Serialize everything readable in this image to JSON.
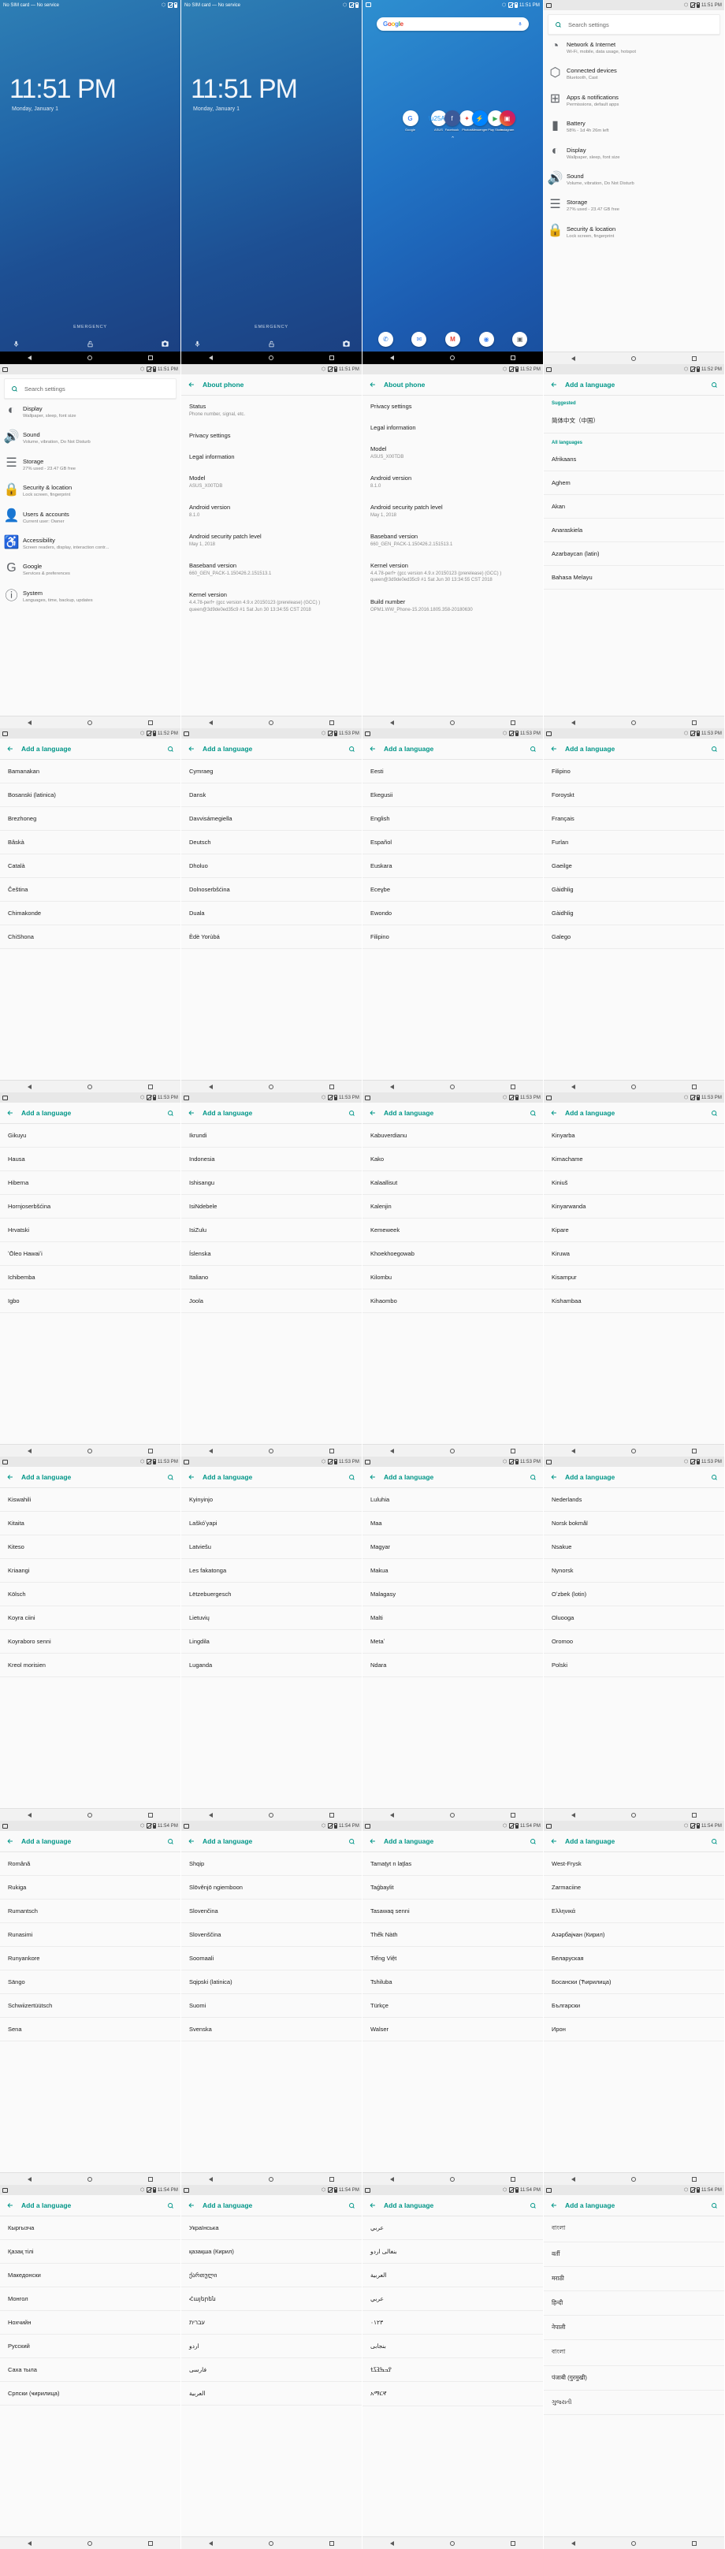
{
  "device": {
    "lockscreen": {
      "carrier": "No SIM card — No service",
      "time": "11:51 PM",
      "date": "Monday, January 1",
      "emergency": "EMERGENCY",
      "mic_icon": "microphone-icon",
      "lock_icon": "unlock-icon",
      "camera_icon": "camera-icon"
    },
    "homescreen": {
      "google_logo": [
        "G",
        "o",
        "o",
        "g",
        "l",
        "e"
      ],
      "mic_icon": "microphone-icon",
      "apps": [
        {
          "label": "Google",
          "color": "#ffffff",
          "glyph": "G",
          "fg": "#4285F4"
        },
        {
          "label": "ASUS",
          "color": "#ffffff",
          "glyph": "■",
          "fg": "#2196F3"
        },
        {
          "label": "Photos",
          "color": "#ffffff",
          "glyph": "✶",
          "fg": "#EA4335"
        },
        {
          "label": "Play Store",
          "color": "#ffffff",
          "glyph": "▶",
          "fg": "#34A853"
        }
      ],
      "apps2": [
        {
          "label": "Facebook",
          "color": "#3b5998",
          "glyph": "f",
          "fg": "#ffffff"
        },
        {
          "label": "Messenger",
          "color": "#0084ff",
          "glyph": "⚡",
          "fg": "#ffffff"
        },
        {
          "label": "Instagram",
          "color": "#c13584",
          "glyph": "▣",
          "fg": "#ffffff"
        }
      ],
      "dock": [
        {
          "name": "phone-icon",
          "color": "#ffffff",
          "glyph": "✆",
          "fg": "#1a73e8"
        },
        {
          "name": "messages-icon",
          "color": "#ffffff",
          "glyph": "✉",
          "fg": "#4285F4"
        },
        {
          "name": "gmail-icon",
          "color": "#ffffff",
          "glyph": "M",
          "fg": "#EA4335"
        },
        {
          "name": "chrome-icon",
          "color": "#ffffff",
          "glyph": "◉",
          "fg": "#4285F4"
        },
        {
          "name": "camera-icon",
          "color": "#ffffff",
          "glyph": "■",
          "fg": "#5f6368"
        }
      ],
      "arrow": "⌃"
    },
    "statusbar": {
      "bt_icon": "bluetooth-icon",
      "sim_icon": "no-sim-icon",
      "battery_icon": "battery-icon",
      "screenshot_icon": "screenshot-icon",
      "times": {
        "t1151": "11:51 PM",
        "t1152": "11:52 PM",
        "t1153": "11:53 PM",
        "t1154": "11:54 PM"
      }
    },
    "navbar": {
      "back": "back-nav-button",
      "home": "home-nav-button",
      "recents": "recents-nav-button"
    }
  },
  "settings_search": {
    "placeholder": "Search settings",
    "search_icon": "search-icon"
  },
  "settings_list_1": {
    "items": [
      {
        "icon": "display-icon",
        "glyph": "◐",
        "title": "Display",
        "subtitle": "Wallpaper, sleep, font size"
      },
      {
        "icon": "sound-icon",
        "glyph": "🔊",
        "title": "Sound",
        "subtitle": "Volume, vibration, Do Not Disturb"
      },
      {
        "icon": "storage-icon",
        "glyph": "☰",
        "title": "Storage",
        "subtitle": "27% used - 23.47 GB free"
      },
      {
        "icon": "lock-icon",
        "glyph": "🔒",
        "title": "Security & location",
        "subtitle": "Lock screen, fingerprint"
      },
      {
        "icon": "user-icon",
        "glyph": "👤",
        "title": "Users & accounts",
        "subtitle": "Current user: Owner"
      },
      {
        "icon": "accessibility-icon",
        "glyph": "♿",
        "title": "Accessibility",
        "subtitle": "Screen readers, display, interaction contr..."
      },
      {
        "icon": "google-icon",
        "glyph": "G",
        "title": "Google",
        "subtitle": "Services & preferences"
      },
      {
        "icon": "system-icon",
        "glyph": "ⓘ",
        "title": "System",
        "subtitle": "Languages, time, backup, updates"
      }
    ]
  },
  "settings_list_2": {
    "items": [
      {
        "icon": "wifi-icon",
        "glyph": "◔",
        "title": "Network & Internet",
        "subtitle": "Wi-Fi, mobile, data usage, hotspot"
      },
      {
        "icon": "bluetooth-icon",
        "glyph": "⬡",
        "title": "Connected devices",
        "subtitle": "Bluetooth, Cast"
      },
      {
        "icon": "apps-icon",
        "glyph": "⊞",
        "title": "Apps & notifications",
        "subtitle": "Permissions, default apps"
      },
      {
        "icon": "battery-icon",
        "glyph": "▮",
        "title": "Battery",
        "subtitle": "58% - 1d 4h 26m left"
      },
      {
        "icon": "display-icon",
        "glyph": "◐",
        "title": "Display",
        "subtitle": "Wallpaper, sleep, font size"
      },
      {
        "icon": "sound-icon",
        "glyph": "🔊",
        "title": "Sound",
        "subtitle": "Volume, vibration, Do Not Disturb"
      },
      {
        "icon": "storage-icon",
        "glyph": "☰",
        "title": "Storage",
        "subtitle": "27% used - 23.47 GB free"
      },
      {
        "icon": "lock-icon",
        "glyph": "🔒",
        "title": "Security & location",
        "subtitle": "Lock screen, fingerprint"
      }
    ]
  },
  "about_phone": {
    "title": "About phone",
    "back_icon": "back-arrow-icon",
    "items_a": [
      {
        "title": "Status",
        "subtitle": "Phone number, signal, etc."
      },
      {
        "title": "Privacy settings",
        "subtitle": ""
      },
      {
        "title": "Legal information",
        "subtitle": ""
      },
      {
        "title": "Model",
        "subtitle": "ASUS_X00TDB"
      },
      {
        "title": "Android version",
        "subtitle": "8.1.0"
      },
      {
        "title": "Android security patch level",
        "subtitle": "May 1, 2018"
      },
      {
        "title": "Baseband version",
        "subtitle": "660_GEN_PACK-1.150426.2.151513.1"
      },
      {
        "title": "Kernel version",
        "subtitle": "4.4.78-perf+ (gcc version 4.9.x 20150123 (prerelease) (GCC) ) queen@3d9de0ed35c9 #1 Sat Jun 30 13:34:55 CST 2018"
      }
    ],
    "items_b": [
      {
        "title": "Privacy settings",
        "subtitle": ""
      },
      {
        "title": "Legal information",
        "subtitle": ""
      },
      {
        "title": "Model",
        "subtitle": "ASUS_X00TDB"
      },
      {
        "title": "Android version",
        "subtitle": "8.1.0"
      },
      {
        "title": "Android security patch level",
        "subtitle": "May 1, 2018"
      },
      {
        "title": "Baseband version",
        "subtitle": "660_GEN_PACK-1.150426.2.151513.1"
      },
      {
        "title": "Kernel version",
        "subtitle": "4.4.78-perf+ (gcc version 4.9.x 20150123 (prerelease) (GCC) ) queen@3d9de0ed35c9 #1 Sat Jun 30 13:34:55 CST 2018"
      },
      {
        "title": "Build number",
        "subtitle": "OPM1.WW_Phone-15.2016.1805.358-20180630"
      }
    ]
  },
  "add_language": {
    "title": "Add a language",
    "back_icon": "back-arrow-icon",
    "search_icon": "search-icon",
    "suggested_header": "Suggested",
    "all_header": "All languages",
    "suggested": [
      "简体中文（中国）"
    ],
    "pages": [
      [
        "Afrikaans",
        "Aghem",
        "Akan",
        "Anaraskiela",
        "Azarbaycan (latin)",
        "Bahasa Melayu"
      ],
      [
        "Bamanakan",
        "Bosanski (latinica)",
        "Brezhoneg",
        "Bâskà",
        "Català",
        "Čeština",
        "Chimakonde",
        "ChiShona"
      ],
      [
        "Cymraeg",
        "Dansk",
        "Davvisámegiella",
        "Deutsch",
        "Dholuo",
        "Dolnoserbšćina",
        "Duala",
        "Èdè Yorùbá"
      ],
      [
        "Eesti",
        "Ekegusii",
        "English",
        "Español",
        "Euskara",
        "Eceɣbe",
        "Ewondo",
        "Filipino"
      ],
      [
        "Filipino",
        "Foroyskt",
        "Français",
        "Furlan",
        "Gaeilge",
        "Gàidhlig",
        "Gàidhlig",
        "Galego"
      ],
      [
        "Gikuyu",
        "Hausa",
        "Hiberna",
        "Hornjoserbšćina",
        "Hrvatski",
        "ʻŌleo Hawaiʻi",
        "Ichibemba",
        "Igbo"
      ],
      [
        "Ikrundi",
        "Indonesia",
        "Ishisangu",
        "IsiNdebele",
        "IsiZulu",
        "Íslenska",
        "Italiano",
        "Joola"
      ],
      [
        "Kabuverdianu",
        "Kako",
        "Kalaallisut",
        "Kalenjin",
        "Kemeweek",
        "Khoekhoegowab",
        "Kilombu",
        "Kihaombo"
      ],
      [
        "Kinyarba",
        "Kimachame",
        "Kiniuš",
        "Kinyarwanda",
        "Kipare",
        "Kiruwa",
        "Kisampur",
        "Kishambaa"
      ],
      [
        "Kiswahili",
        "Kitaita",
        "Kiteso",
        "Kriaangi",
        "Kölsch",
        "Koyra ciini",
        "Koyraboro senni",
        "Kreol morisien"
      ],
      [
        "Kyinyinjo",
        "Laškóʼyapi",
        "Latviešu",
        "Les fakatonga",
        "Lëtzebuergesch",
        "Lietuvių",
        "Lingdila",
        "Luganda"
      ],
      [
        "Luluhia",
        "Maa",
        "Magyar",
        "Makua",
        "Malagasy",
        "Malti",
        "Metaʼ",
        "Ndara"
      ],
      [
        "Nederlands",
        "Norsk bokmål",
        "Nsakue",
        "Nynorsk",
        "Oʻzbek (lotin)",
        "Oluooga",
        "Oromoo",
        "Polski"
      ],
      [
        "Română",
        "Rukiga",
        "Rumantsch",
        "Runasimi",
        "Runyankore",
        "Sängo",
        "Schwiizertüütsch",
        "Sena"
      ],
      [
        "Shqip",
        "Slōvěnjō ngiemboon",
        "Slovenčina",
        "Slovenščina",
        "Soomaali",
        "Sqipski (latinica)",
        "Suomi",
        "Svenska"
      ],
      [
        "Tamațyt n laţlas",
        "Taǵbaylit",
        "Tasawaq senni",
        "Thếk Nàth",
        "Tiếng Việt",
        "Tshiluba",
        "Türkçe",
        "Walser"
      ],
      [
        "West-Frysk",
        "Zarmaciine",
        "Ελληνικά",
        "Азәрбајҹан (Кирил)",
        "Беларуская",
        "Босански (Ћирилица)",
        "Български",
        "Ирон"
      ],
      [
        "Кыргызча",
        "Қазақ тілі",
        "Македонски",
        "Монгол",
        "Нохчийн",
        "Русский",
        "Саха тыла",
        "Српски (ҹирилица)"
      ],
      [
        "Українська",
        "қазақша (Кирил)",
        "ქართული",
        "Հայերեն",
        "עברית",
        "اردو",
        "فارسی",
        "العربية"
      ],
      [
        "عربي",
        "بنغالی اردو",
        "العربية",
        "عربي",
        "٠١٢٣",
        "بنجابی",
        "ߐߏߒߔߖߙ",
        "አማርኛ"
      ],
      [
        "বাংলা",
        "वर्ती",
        "मराठी",
        "हिन्दी",
        "नेपाली",
        "বাংলা",
        "पंजाबी (गुरमुखी)",
        "ગુજરાતી"
      ]
    ]
  }
}
